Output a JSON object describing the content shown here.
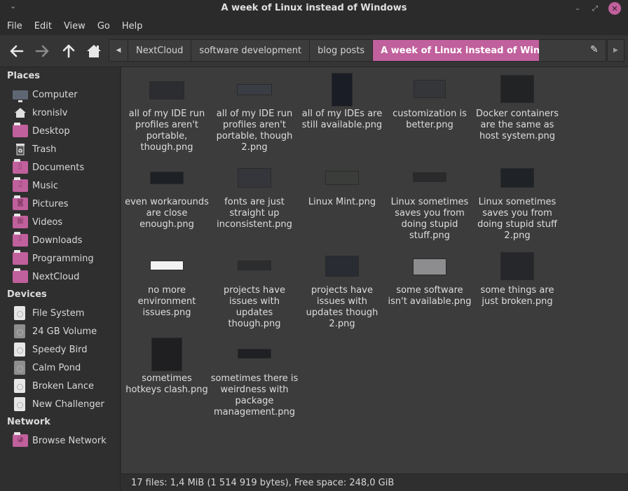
{
  "window": {
    "title": "A week of Linux instead of Windows",
    "menu_icon": "chevron-down",
    "controls": {
      "minimize": "–",
      "maximize": "⤢",
      "close": "✕"
    }
  },
  "menubar": [
    "File",
    "Edit",
    "View",
    "Go",
    "Help"
  ],
  "toolbar": {
    "back": "🡐",
    "forward": "🡒",
    "up": "🡑",
    "home": "⌂",
    "breadcrumbs": [
      "NextCloud",
      "software development",
      "blog posts",
      "A week of Linux instead of Windows"
    ],
    "crumb_prev": "◀",
    "crumb_next": "▶",
    "edit": "✎"
  },
  "sidebar": {
    "places_title": "Places",
    "places": [
      {
        "label": "Computer",
        "icon": "computer"
      },
      {
        "label": "kronislv",
        "icon": "home"
      },
      {
        "label": "Desktop",
        "icon": "folder"
      },
      {
        "label": "Trash",
        "icon": "trash"
      },
      {
        "label": "Documents",
        "icon": "folder-documents"
      },
      {
        "label": "Music",
        "icon": "folder-music"
      },
      {
        "label": "Pictures",
        "icon": "folder-pictures"
      },
      {
        "label": "Videos",
        "icon": "folder-videos"
      },
      {
        "label": "Downloads",
        "icon": "folder-downloads"
      },
      {
        "label": "Programming",
        "icon": "folder"
      },
      {
        "label": "NextCloud",
        "icon": "folder"
      }
    ],
    "devices_title": "Devices",
    "devices": [
      {
        "label": "File System",
        "mounted": true
      },
      {
        "label": "24 GB Volume",
        "mounted": false
      },
      {
        "label": "Speedy Bird",
        "mounted": true
      },
      {
        "label": "Calm Pond",
        "mounted": false
      },
      {
        "label": "Broken Lance",
        "mounted": true
      },
      {
        "label": "New Challenger",
        "mounted": true
      }
    ],
    "network_title": "Network",
    "network": [
      {
        "label": "Browse Network",
        "icon": "folder-network"
      }
    ]
  },
  "files": [
    {
      "name": "all of my IDE run profiles aren't portable, though.png"
    },
    {
      "name": "all of my IDE run profiles aren't portable, though 2.png"
    },
    {
      "name": "all of my IDEs are still available.png"
    },
    {
      "name": "customization is better.png"
    },
    {
      "name": "Docker containers are the same as host system.png"
    },
    {
      "name": "even workarounds are close enough.png"
    },
    {
      "name": "fonts are just straight up inconsistent.png"
    },
    {
      "name": "Linux Mint.png"
    },
    {
      "name": "Linux sometimes saves you from doing stupid stuff.png"
    },
    {
      "name": "Linux sometimes saves you from doing stupid stuff 2.png"
    },
    {
      "name": "no more environment issues.png"
    },
    {
      "name": "projects have issues with updates though.png"
    },
    {
      "name": "projects have issues with updates though 2.png"
    },
    {
      "name": "some software isn't available.png"
    },
    {
      "name": "some things are just broken.png"
    },
    {
      "name": "sometimes hotkeys clash.png"
    },
    {
      "name": "sometimes there is weirdness with package management.png"
    }
  ],
  "status": "17 files: 1,4 MiB (1 514 919 bytes), Free space: 248,0 GiB",
  "colors": {
    "accent": "#c0609c",
    "background": "#3c3c3c",
    "sidebar": "#2f2f2f"
  }
}
